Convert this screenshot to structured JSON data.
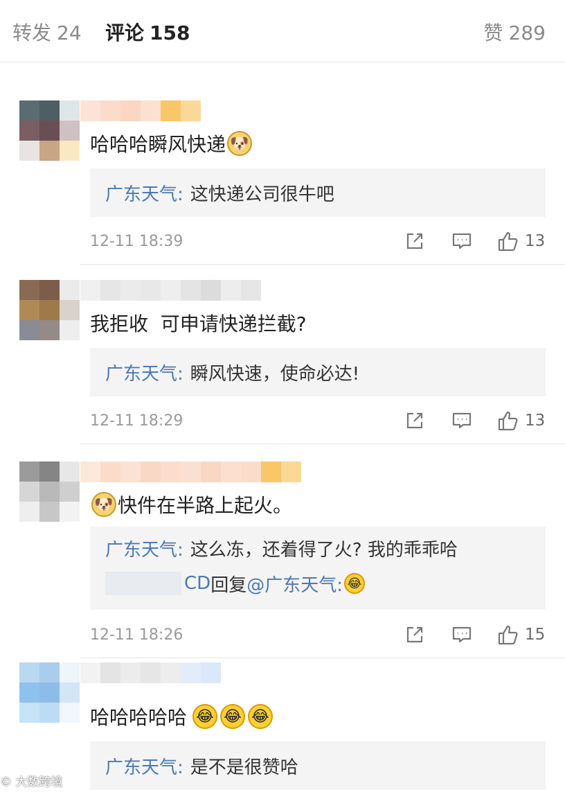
{
  "tabs": {
    "repost": {
      "label": "转发",
      "count": "24"
    },
    "comment": {
      "label": "评论",
      "count": "158"
    },
    "like": {
      "label": "赞",
      "count": "289"
    }
  },
  "comments": [
    {
      "text": "哈哈哈瞬风快递",
      "reply_author": "广东天气:",
      "reply_text": "这快递公司很牛吧",
      "time": "12-11 18:39",
      "likes": "13"
    },
    {
      "text": "我拒收  可申请快递拦截?",
      "reply_author": "广东天气:",
      "reply_text": "瞬风快速，使命必达!",
      "time": "12-11 18:29",
      "likes": "13"
    },
    {
      "text": "快件在半路上起火。",
      "reply_author": "广东天气:",
      "reply_text": "这么冻，还着得了火? 我的乖乖哈",
      "reply2_prefix": "CD",
      "reply2_mid": "回复",
      "reply2_at": "@广东天气:",
      "time": "12-11 18:26",
      "likes": "15"
    },
    {
      "text": "哈哈哈哈哈",
      "reply_author": "广东天气:",
      "reply_text": "是不是很赞哈"
    }
  ],
  "watermark": "大数跨境",
  "colors": {
    "link": "#4b79b0",
    "reply_bg": "#f4f4f4",
    "icon": "#777777",
    "doge": "#f6d36f",
    "laugh": "#ffcf33"
  }
}
